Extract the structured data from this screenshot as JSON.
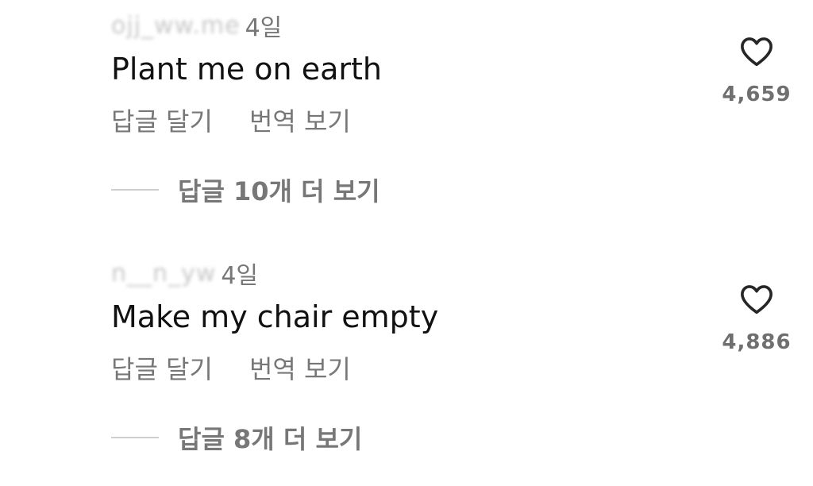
{
  "comments": [
    {
      "username": "ojj_ww.me",
      "time": "4일",
      "text": "Plant me on earth",
      "reply_label": "답글 달기",
      "translate_label": "번역 보기",
      "view_replies_label": "답글 10개 더 보기",
      "like_count": "4,659"
    },
    {
      "username": "n__n_yw",
      "time": "4일",
      "text": "Make my chair empty",
      "reply_label": "답글 달기",
      "translate_label": "번역 보기",
      "view_replies_label": "답글 8개 더 보기",
      "like_count": "4,886"
    }
  ],
  "icons": {
    "like": "heart-outline-icon"
  },
  "colors": {
    "text": "#111111",
    "secondary": "#777777",
    "divider": "#cfcfcf"
  }
}
